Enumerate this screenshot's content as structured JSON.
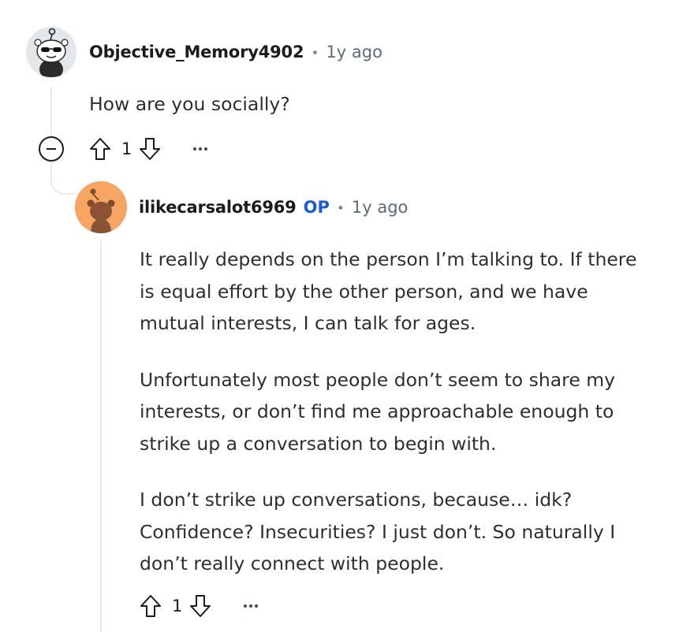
{
  "comment": {
    "author": "Objective_Memory4902",
    "separator": "•",
    "time": "1y ago",
    "text": "How are you socially?",
    "score": "1",
    "avatar_icon": "snoo-sunglasses-avatar-icon"
  },
  "reply": {
    "author": "ilikecarsalot6969",
    "op_badge": "OP",
    "separator": "•",
    "time": "1y ago",
    "paragraphs": [
      "It really depends on the person I’m talking to. If there is equal effort by the other person, and we have mutual interests, I can talk for ages.",
      "Unfortunately most people don’t seem to share my interests, or don’t find me approachable enough to strike up a conversation to begin with.",
      "I don’t strike up conversations, because… idk? Confidence? Insecurities? I just don’t. So naturally I don’t really connect with people."
    ],
    "score": "1",
    "avatar_icon": "snoo-orange-avatar-icon"
  },
  "colors": {
    "op_blue": "#1a5cd1",
    "thread_line": "#e5ebee",
    "avatar_orange": "#f7a560"
  }
}
